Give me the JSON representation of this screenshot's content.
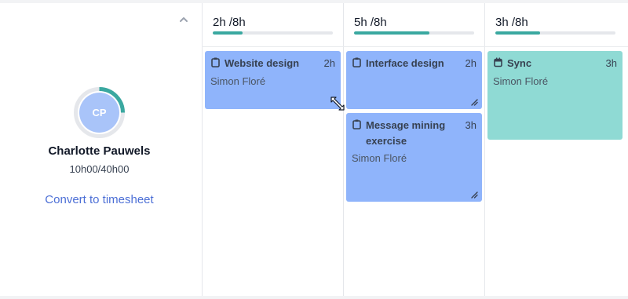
{
  "person": {
    "initials": "CP",
    "name": "Charlotte Pauwels",
    "hours": "10h00/40h00",
    "progress": 0.25,
    "convert_label": "Convert to timesheet",
    "collapse_icon": "chevron-up-icon"
  },
  "days": [
    {
      "hours_label": "2h /8h",
      "progress": 0.25
    },
    {
      "hours_label": "5h /8h",
      "progress": 0.625
    },
    {
      "hours_label": "3h /8h",
      "progress": 0.375
    }
  ],
  "tasks": [
    {
      "title_line1": "Website design",
      "duration": "2h",
      "assignee": "Simon Floré",
      "icon": "clipboard-icon",
      "color": "#8fb4fb"
    },
    {
      "title_line1": "Interface design",
      "duration": "2h",
      "assignee": "Simon Floré",
      "icon": "clipboard-icon",
      "color": "#8fb4fb"
    },
    {
      "title_line1": "Message mining",
      "title_line2": "exercise",
      "duration": "3h",
      "assignee": "Simon Floré",
      "icon": "clipboard-icon",
      "color": "#8fb4fb"
    },
    {
      "title_line1": "Sync",
      "duration": "3h",
      "assignee": "Simon Floré",
      "icon": "calendar-icon",
      "color": "#8fdad4"
    }
  ],
  "colors": {
    "accent": "#3aa8a0",
    "link": "#4c6fd6",
    "task_blue": "#8fb4fb",
    "task_teal": "#8fdad4",
    "avatar": "#a9c4f9"
  }
}
